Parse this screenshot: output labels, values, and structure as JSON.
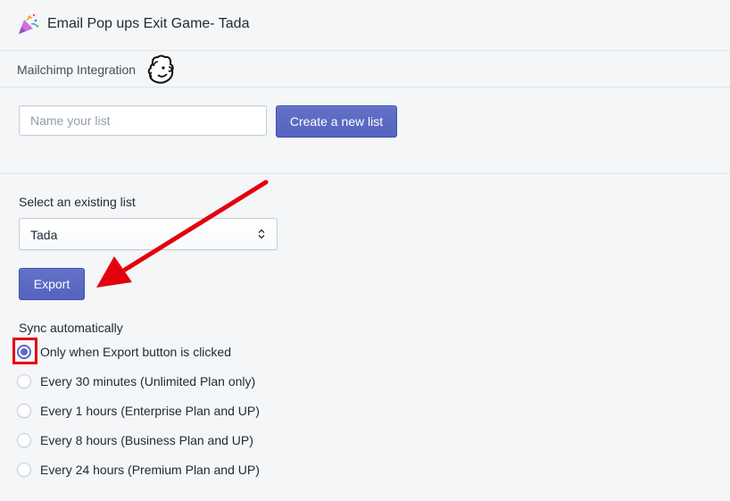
{
  "app": {
    "title": "Email Pop ups Exit Game- Tada",
    "icon": "party-popper-icon"
  },
  "integration": {
    "title": "Mailchimp Integration",
    "logo": "mailchimp-logo-icon"
  },
  "create_list": {
    "placeholder": "Name your list",
    "value": "",
    "button_label": "Create a new list"
  },
  "existing_list": {
    "label": "Select an existing list",
    "selected": "Tada"
  },
  "export": {
    "button_label": "Export"
  },
  "sync": {
    "label": "Sync automatically",
    "options": [
      {
        "label": "Only when Export button is clicked",
        "checked": true
      },
      {
        "label": "Every 30 minutes (Unlimited Plan only)",
        "checked": false
      },
      {
        "label": "Every 1 hours (Enterprise Plan and UP)",
        "checked": false
      },
      {
        "label": "Every 8 hours (Business Plan and UP)",
        "checked": false
      },
      {
        "label": "Every 24 hours (Premium Plan and UP)",
        "checked": false
      }
    ]
  },
  "colors": {
    "primary": "#5c6ac4",
    "annotation": "#e3000f",
    "background": "#f4f6f8"
  }
}
